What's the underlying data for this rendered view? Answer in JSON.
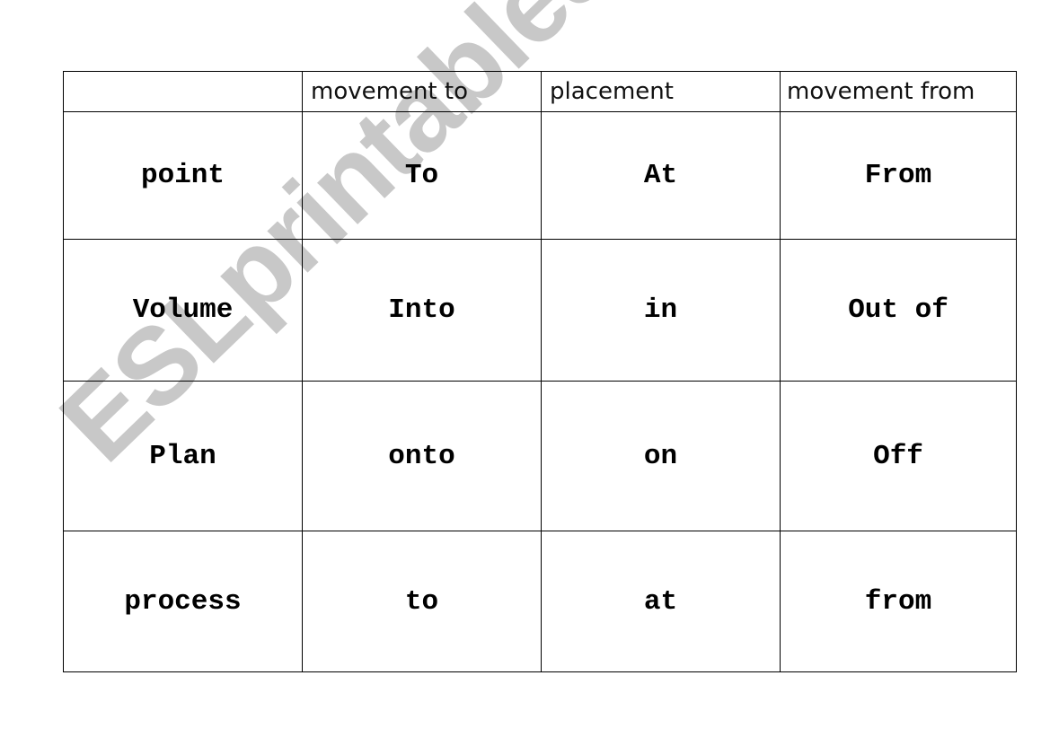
{
  "watermark": "ESLprintables.com",
  "table": {
    "headers": [
      "",
      "movement to",
      "placement",
      "movement from"
    ],
    "rows": [
      [
        "point",
        "To",
        "At",
        "From"
      ],
      [
        "Volume",
        "Into",
        "in",
        "Out of"
      ],
      [
        "Plan",
        "onto",
        "on",
        "Off"
      ],
      [
        "process",
        "to",
        "at",
        "from"
      ]
    ]
  }
}
